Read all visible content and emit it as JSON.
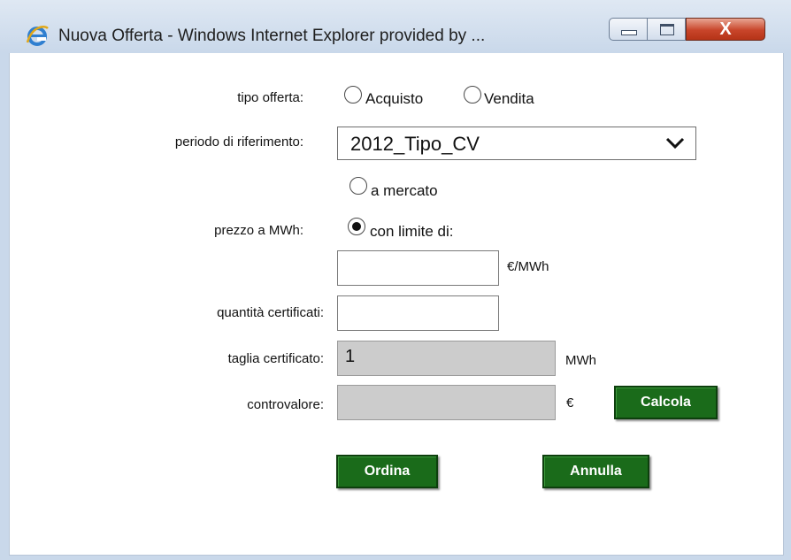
{
  "window": {
    "title": "Nuova Offerta - Windows Internet Explorer provided by ...",
    "close_glyph": "X",
    "icons": {
      "app": "ie-icon",
      "minimize": "minimize-icon",
      "maximize": "maximize-icon",
      "close": "close-icon"
    }
  },
  "form": {
    "tipo_offerta": {
      "label": "tipo offerta:",
      "options": [
        {
          "label": "Acquisto",
          "checked": false
        },
        {
          "label": "Vendita",
          "checked": false
        }
      ]
    },
    "periodo": {
      "label": "periodo di riferimento:",
      "selected": "2012_Tipo_CV"
    },
    "prezzo": {
      "label": "prezzo a MWh:",
      "options": [
        {
          "label": "a mercato",
          "checked": false
        },
        {
          "label": "con limite di:",
          "checked": true
        }
      ],
      "limit_value": "",
      "unit": "€/MWh"
    },
    "quantita": {
      "label": "quantità certificati:",
      "value": ""
    },
    "taglia": {
      "label": "taglia certificato:",
      "value": "1",
      "unit": "MWh"
    },
    "controvalore": {
      "label": "controvalore:",
      "value": "",
      "unit": "€",
      "calc_label": "Calcola"
    }
  },
  "actions": {
    "ordina": "Ordina",
    "annulla": "Annulla"
  },
  "colors": {
    "button_green": "#1a6b1a",
    "disabled_field": "#cccccc",
    "close_red": "#c8452a"
  }
}
